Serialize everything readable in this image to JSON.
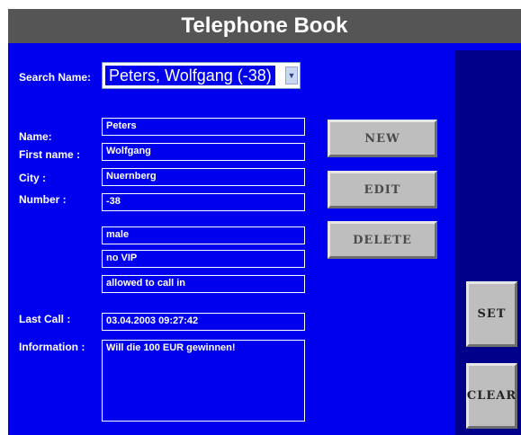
{
  "header": {
    "title": "Telephone Book"
  },
  "search": {
    "label": "Search Name:",
    "selected": "Peters, Wolfgang (-38)",
    "arrow_icon": "chevron-down-icon"
  },
  "form": {
    "name_label": "Name:",
    "name_value": "Peters",
    "first_name_label": "First name :",
    "first_name_value": "Wolfgang",
    "city_label": "City :",
    "city_value": "Nuernberg",
    "number_label": "Number :",
    "number_value": "-38",
    "gender_value": "male",
    "vip_value": "no VIP",
    "call_in_value": "allowed to call in",
    "last_call_label": "Last Call :",
    "last_call_value": "03.04.2003 09:27:42",
    "information_label": "Information :",
    "information_value": "Will die 100 EUR gewinnen!"
  },
  "buttons": {
    "new": "NEW",
    "edit": "EDIT",
    "delete": "DELETE",
    "set": "SET",
    "clear": "CLEAR"
  },
  "colors": {
    "background": "#0000ee",
    "title_bar": "#555555",
    "side_panel": "#00008b",
    "button": "#bebebe"
  }
}
